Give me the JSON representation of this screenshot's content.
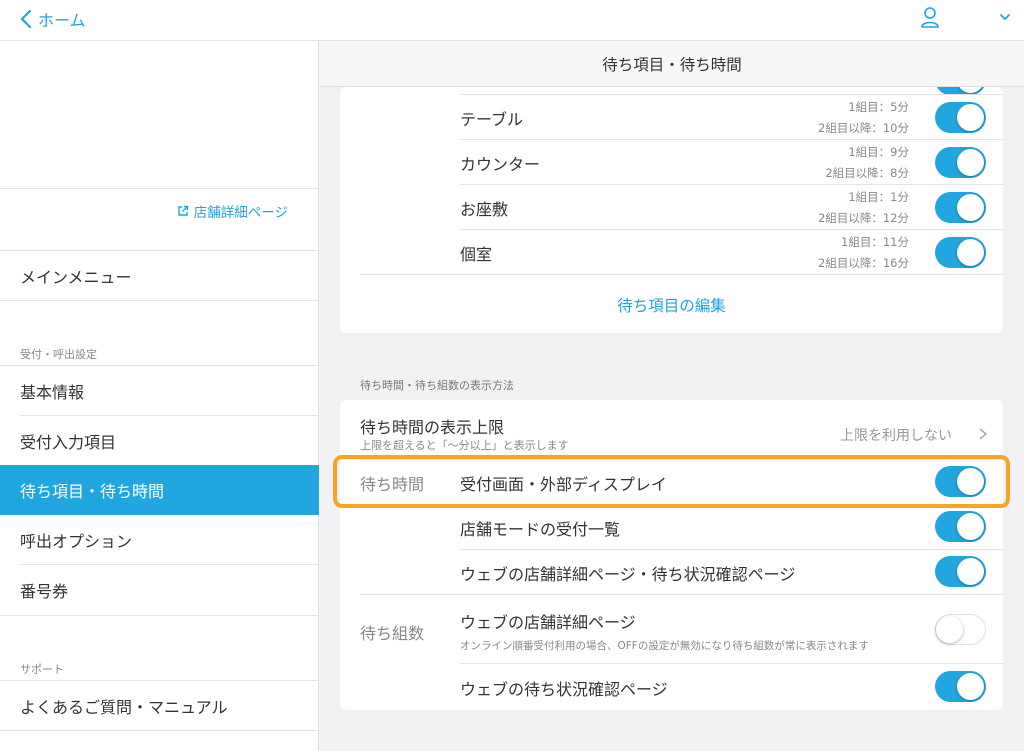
{
  "topbar": {
    "back_label": "ホーム"
  },
  "sidebar": {
    "shop_link": "店舗詳細ページ",
    "main_menu": "メインメニュー",
    "section_reception": "受付・呼出設定",
    "items": [
      "基本情報",
      "受付入力項目",
      "待ち項目・待ち時間",
      "呼出オプション",
      "番号券"
    ],
    "section_support": "サポート",
    "faq": "よくあるご質問・マニュアル"
  },
  "main": {
    "title": "待ち項目・待ち時間",
    "wait_items": [
      {
        "name": "テーブル",
        "first": "1組目：5分",
        "after": "2組目以降：10分",
        "enabled": true
      },
      {
        "name": "カウンター",
        "first": "1組目：9分",
        "after": "2組目以降：8分",
        "enabled": true
      },
      {
        "name": "お座敷",
        "first": "1組目：1分",
        "after": "2組目以降：12分",
        "enabled": true
      },
      {
        "name": "個室",
        "first": "1組目：11分",
        "after": "2組目以降：16分",
        "enabled": true
      }
    ],
    "edit_label": "待ち項目の編集",
    "display_section": "待ち時間・待ち組数の表示方法",
    "limit_title": "待ち時間の表示上限",
    "limit_desc": "上限を超えると「〜分以上」と表示します",
    "limit_value": "上限を利用しない",
    "wait_time_group": "待ち時間",
    "wait_time_rows": [
      {
        "label": "受付画面・外部ディスプレイ",
        "enabled": true
      },
      {
        "label": "店舗モードの受付一覧",
        "enabled": true
      },
      {
        "label": "ウェブの店舗詳細ページ・待ち状況確認ページ",
        "enabled": true
      }
    ],
    "wait_count_group": "待ち組数",
    "wait_count_rows": [
      {
        "label": "ウェブの店舗詳細ページ",
        "note": "オンライン順番受付利用の場合、OFFの設定が無効になり待ち組数が常に表示されます",
        "enabled": false
      },
      {
        "label": "ウェブの待ち状況確認ページ",
        "enabled": true
      }
    ]
  },
  "colors": {
    "accent": "#22a6df",
    "highlight": "#f7a325"
  }
}
